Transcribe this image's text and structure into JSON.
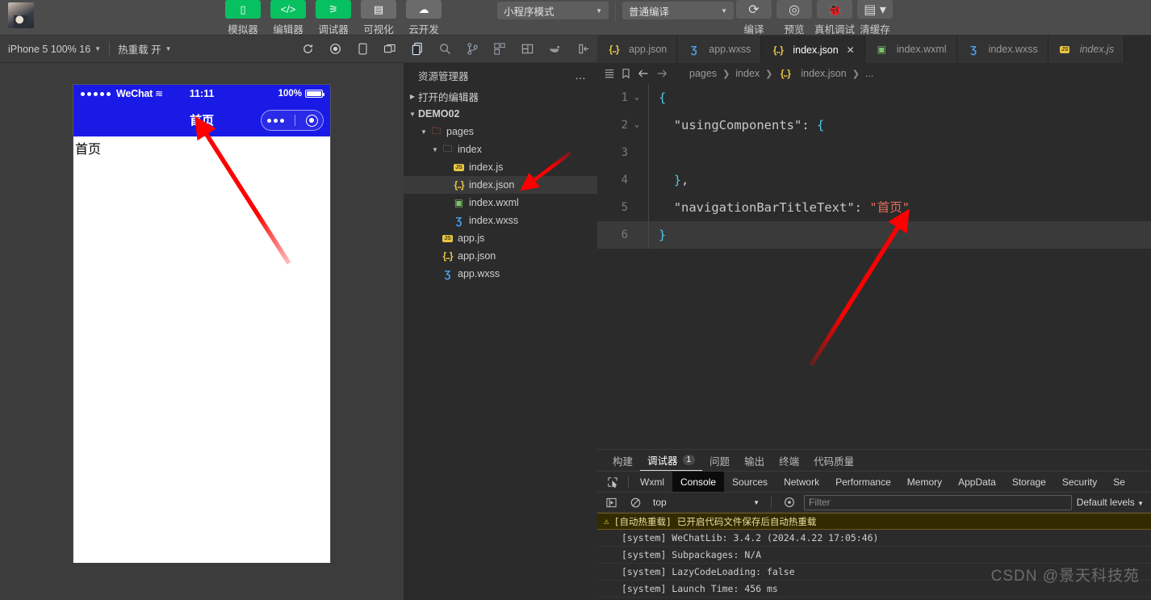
{
  "toolbar": {
    "avatar_name": "user-avatar",
    "modes": [
      {
        "icon": "phone-icon",
        "glyph": "▯",
        "label": "模拟器",
        "style": "green"
      },
      {
        "icon": "code-icon",
        "glyph": "</>",
        "label": "编辑器",
        "style": "green"
      },
      {
        "icon": "sliders-icon",
        "glyph": "⚞",
        "label": "调试器",
        "style": "green"
      },
      {
        "icon": "layout-icon",
        "glyph": "▤",
        "label": "可视化",
        "style": "grey"
      },
      {
        "icon": "cloud-icon",
        "glyph": "☁",
        "label": "云开发",
        "style": "grey"
      }
    ],
    "project_mode": "小程序模式",
    "compile_mode": "普通编译",
    "actions": [
      {
        "icon": "refresh-icon",
        "glyph": "⟳",
        "label": "编译"
      },
      {
        "icon": "eye-icon",
        "glyph": "◎",
        "label": "预览"
      },
      {
        "icon": "bug-icon",
        "glyph": "🐞",
        "label": "真机调试"
      },
      {
        "icon": "layers-icon",
        "glyph": "▤",
        "label": "清缓存"
      }
    ]
  },
  "simbar": {
    "device": "iPhone 5 100% 16",
    "hot_reload": "热重载 开",
    "icons": [
      "refresh-icon",
      "record-icon",
      "device-icon",
      "window-icon"
    ]
  },
  "simulator": {
    "status": {
      "carrier": "WeChat",
      "wifi": "≋",
      "time": "11:11",
      "battery_text": "100%"
    },
    "nav_title": "首页",
    "page_text": "首页"
  },
  "activity_bar": {
    "icons": [
      "explorer-icon",
      "search-icon",
      "source-control-icon",
      "extensions-icon",
      "split-icon",
      "docker-icon",
      "collapse-panel-icon"
    ]
  },
  "explorer": {
    "title": "资源管理器",
    "more": "…",
    "open_editors": "打开的编辑器",
    "project": "DEMO02",
    "tree": [
      {
        "label": "pages",
        "icon": "folder-open-icon",
        "depth": 1,
        "twisty": "▼",
        "selected": false
      },
      {
        "label": "index",
        "icon": "folder-plain-icon",
        "depth": 2,
        "twisty": "▼",
        "selected": false
      },
      {
        "label": "index.js",
        "icon": "js-file-icon",
        "depth": 3,
        "twisty": "",
        "selected": false
      },
      {
        "label": "index.json",
        "icon": "json-file-icon",
        "depth": 3,
        "twisty": "",
        "selected": true
      },
      {
        "label": "index.wxml",
        "icon": "wxml-file-icon",
        "depth": 3,
        "twisty": "",
        "selected": false
      },
      {
        "label": "index.wxss",
        "icon": "wxss-file-icon",
        "depth": 3,
        "twisty": "",
        "selected": false
      },
      {
        "label": "app.js",
        "icon": "js-file-icon",
        "depth": 2,
        "twisty": "",
        "selected": false
      },
      {
        "label": "app.json",
        "icon": "json-file-icon",
        "depth": 2,
        "twisty": "",
        "selected": false
      },
      {
        "label": "app.wxss",
        "icon": "wxss-file-icon",
        "depth": 2,
        "twisty": "",
        "selected": false
      }
    ]
  },
  "editor": {
    "tabs": [
      {
        "label": "app.json",
        "icon": "json-file-icon",
        "active": false,
        "italic": false,
        "close": false
      },
      {
        "label": "app.wxss",
        "icon": "wxss-file-icon",
        "active": false,
        "italic": false,
        "close": false
      },
      {
        "label": "index.json",
        "icon": "json-file-icon",
        "active": true,
        "italic": false,
        "close": true
      },
      {
        "label": "index.wxml",
        "icon": "wxml-file-icon",
        "active": false,
        "italic": false,
        "close": false
      },
      {
        "label": "index.wxss",
        "icon": "wxss-file-icon",
        "active": false,
        "italic": false,
        "close": false
      },
      {
        "label": "index.js",
        "icon": "js-file-icon",
        "active": false,
        "italic": true,
        "close": false
      }
    ],
    "breadcrumb": [
      "pages",
      "index",
      "index.json",
      "..."
    ],
    "breadcrumb_file_icon": "json-file-icon",
    "lines": [
      {
        "no": "1",
        "fold": "⌄",
        "text": "{"
      },
      {
        "no": "2",
        "fold": "⌄",
        "text": "  \"usingComponents\": {"
      },
      {
        "no": "3",
        "fold": "",
        "text": ""
      },
      {
        "no": "4",
        "fold": "",
        "text": "  },"
      },
      {
        "no": "5",
        "fold": "",
        "text": "  \"navigationBarTitleText\": \"首页\""
      },
      {
        "no": "6",
        "fold": "",
        "text": "}"
      }
    ]
  },
  "panel": {
    "tabs": [
      {
        "label": "构建",
        "active": false,
        "count": ""
      },
      {
        "label": "调试器",
        "active": true,
        "count": "1"
      },
      {
        "label": "问题",
        "active": false,
        "count": ""
      },
      {
        "label": "输出",
        "active": false,
        "count": ""
      },
      {
        "label": "终端",
        "active": false,
        "count": ""
      },
      {
        "label": "代码质量",
        "active": false,
        "count": ""
      }
    ],
    "devtools_tabs": [
      {
        "label": "Wxml",
        "active": false
      },
      {
        "label": "Console",
        "active": true
      },
      {
        "label": "Sources",
        "active": false
      },
      {
        "label": "Network",
        "active": false
      },
      {
        "label": "Performance",
        "active": false
      },
      {
        "label": "Memory",
        "active": false
      },
      {
        "label": "AppData",
        "active": false
      },
      {
        "label": "Storage",
        "active": false
      },
      {
        "label": "Security",
        "active": false
      },
      {
        "label": "Se",
        "active": false
      }
    ],
    "filter": {
      "context": "top",
      "placeholder": "Filter",
      "value": "",
      "levels": "Default levels"
    },
    "console_rows": [
      {
        "type": "warn",
        "text": "[自动热重载] 已开启代码文件保存后自动热重载"
      },
      {
        "type": "system",
        "text": "[system] WeChatLib: 3.4.2 (2024.4.22 17:05:46)"
      },
      {
        "type": "system",
        "text": "[system] Subpackages: N/A"
      },
      {
        "type": "system",
        "text": "[system] LazyCodeLoading: false"
      },
      {
        "type": "system",
        "text": "[system] Launch Time: 456 ms"
      }
    ]
  },
  "watermark": "CSDN @景天科技苑",
  "colors": {
    "accent_green": "#07c160",
    "nav_blue": "#1a1ae6",
    "annotation_red": "#ff0000",
    "editor_bg": "#2b2b2b",
    "chrome_bg": "#3c3c3c"
  }
}
